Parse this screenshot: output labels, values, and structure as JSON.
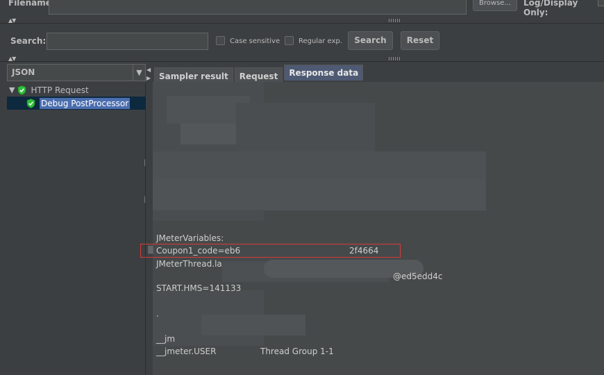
{
  "top": {
    "filename_label": "Filename",
    "browse_label": "Browse...",
    "log_display_label": "Log/Display Only:"
  },
  "search": {
    "label": "Search:",
    "value": "",
    "case_sensitive_label": "Case sensitive",
    "regular_exp_label": "Regular exp.",
    "search_button": "Search",
    "reset_button": "Reset"
  },
  "renderer": {
    "selected": "JSON"
  },
  "tree": {
    "items": [
      {
        "label": "HTTP Request",
        "level": 0,
        "expanded": true
      },
      {
        "label": "Debug PostProcessor",
        "level": 1,
        "selected": true
      }
    ]
  },
  "tabs": [
    {
      "label": "Sampler result",
      "active": false
    },
    {
      "label": "Request",
      "active": false
    },
    {
      "label": "Response data",
      "active": true
    }
  ],
  "response": {
    "lines": [
      "JMeterVariables:",
      "Coupon1_code=eb6",
      "JMeterThread.la",
      "START.HMS=141133",
      "__jm",
      "__jmeter.USER",
      "2f4664",
      "@ed5edd4c",
      "Thread Group 1-1",
      "."
    ]
  },
  "colors": {
    "background": "#3c3f41",
    "content_bg": "#45494a",
    "selection": "#4b6eaf",
    "active_tab": "#4e5a73",
    "highlight_border": "#d83a3a",
    "check_green": "#2fbf3a"
  }
}
